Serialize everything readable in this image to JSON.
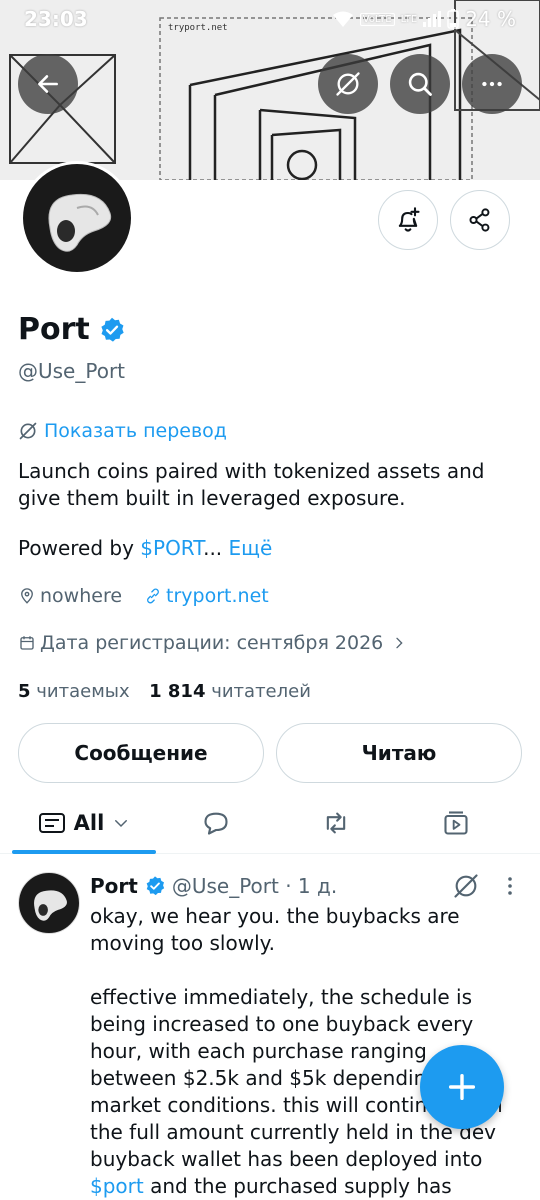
{
  "status_bar": {
    "time": "23:03",
    "volte": "VoLTE",
    "lte": "LTE",
    "battery": "24 %"
  },
  "banner": {
    "url_label": "tryport.net"
  },
  "header_icons": {
    "back": "arrow-left-icon",
    "translate": "translate-icon",
    "search": "search-icon",
    "more": "more-horizontal-icon",
    "notify": "bell-plus-icon",
    "share": "share-icon"
  },
  "profile": {
    "name": "Port",
    "handle": "@Use_Port",
    "translate_label": "Показать перевод",
    "bio": "Launch coins paired with tokenized assets and give them built in leveraged exposure.",
    "powered_prefix": "Powered by ",
    "powered_link": "$PORT",
    "powered_ellipsis": "...",
    "more_label": "Ещё",
    "location": "nowhere",
    "website": "tryport.net",
    "joined": "Дата регистрации: сентября 2026",
    "following_count": "5",
    "following_label": "читаемых",
    "followers_count": "1 814",
    "followers_label": "читателей"
  },
  "buttons": {
    "message": "Сообщение",
    "following": "Читаю"
  },
  "tabs": {
    "all_label": "All"
  },
  "post": {
    "name": "Port",
    "handle_time": "@Use_Port · 1 д.",
    "text": "okay, we hear you. the buybacks are moving too slowly.\n\neffective immediately, the schedule is being increased to one buyback every hour, with each purchase ranging between $2.5k and $5k depending on market conditions. this will continue until the full amount currently held in the dev buyback wallet has been deployed into",
    "cashtag": "$port",
    "text_tail": " and the purchased supply has"
  },
  "colors": {
    "accent": "#1d9bf0",
    "verified": "#1d9bf0",
    "text": "#0f1419",
    "secondary": "#536471"
  }
}
